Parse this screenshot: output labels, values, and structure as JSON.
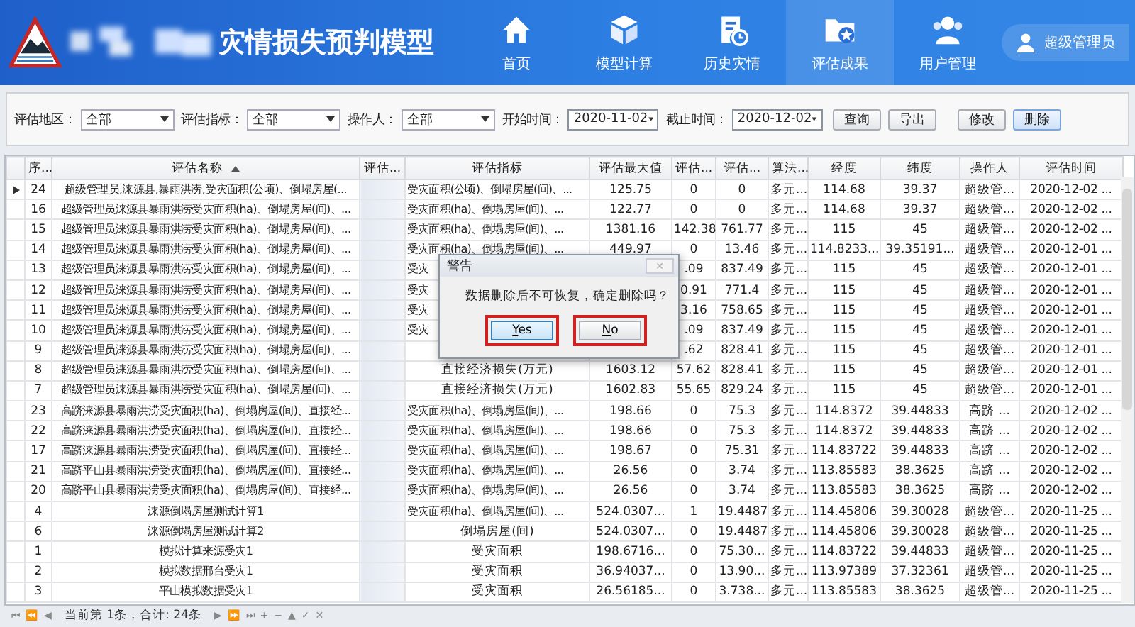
{
  "header": {
    "title": "灾情损失预判模型",
    "nav": [
      {
        "label": "首页",
        "selected": false
      },
      {
        "label": "模型计算",
        "selected": false
      },
      {
        "label": "历史灾情",
        "selected": false
      },
      {
        "label": "评估成果",
        "selected": true
      },
      {
        "label": "用户管理",
        "selected": false
      }
    ],
    "user": "超级管理员"
  },
  "filters": [
    {
      "label": "评估地区：",
      "value": "全部",
      "kind": "select"
    },
    {
      "label": "评估指标：",
      "value": "全部",
      "kind": "select"
    },
    {
      "label": "操作人：",
      "value": "全部",
      "kind": "select"
    },
    {
      "label": "开始时间：",
      "value": "2020-11-02",
      "kind": "date"
    },
    {
      "label": "截止时间：",
      "value": "2020-12-02",
      "kind": "date"
    }
  ],
  "actions": [
    {
      "label": "查询",
      "highlighted": false
    },
    {
      "label": "导出",
      "highlighted": false
    },
    {
      "label": "修改",
      "highlighted": false
    },
    {
      "label": "删除",
      "highlighted": true
    }
  ],
  "table": {
    "columns": [
      {
        "label": "序..."
      },
      {
        "label": "评估名称",
        "sorted_ascending": true
      },
      {
        "label": "评估..."
      },
      {
        "label": "评估指标"
      },
      {
        "label": "评估最大值"
      },
      {
        "label": "评估..."
      },
      {
        "label": "评估..."
      },
      {
        "label": "算法..."
      },
      {
        "label": "经度"
      },
      {
        "label": "纬度"
      },
      {
        "label": "操作人"
      },
      {
        "label": "评估时间"
      }
    ],
    "rows": [
      {
        "selected": true,
        "no": "24",
        "name": "超级管理员,涞源县,暴雨洪涝,受灾面积(公顷)、倒塌房屋(...",
        "indicator": "受灾面积(公顷)、倒塌房屋(间)、...",
        "max": "125.75",
        "v1": "0",
        "v2": "0",
        "algo": "多元...",
        "lon": "114.68",
        "lat": "39.37",
        "operator": "超级管...",
        "time": "2020-12-02 ..."
      },
      {
        "selected": false,
        "no": "16",
        "name": "超级管理员涞源县暴雨洪涝受灾面积(ha)、倒塌房屋(间)、...",
        "indicator": "受灾面积(ha)、倒塌房屋(间)、...",
        "max": "122.77",
        "v1": "0",
        "v2": "0",
        "algo": "多元...",
        "lon": "114.68",
        "lat": "39.37",
        "operator": "超级管...",
        "time": "2020-12-02 ..."
      },
      {
        "selected": false,
        "no": "15",
        "name": "超级管理员涞源县暴雨洪涝受灾面积(ha)、倒塌房屋(间)、...",
        "indicator": "受灾面积(ha)、倒塌房屋(间)、...",
        "max": "1381.16",
        "v1": "142.38",
        "v2": "761.77",
        "algo": "多元...",
        "lon": "115",
        "lat": "45",
        "operator": "超级管...",
        "time": "2020-12-02 ..."
      },
      {
        "selected": false,
        "no": "14",
        "name": "超级管理员涞源县暴雨洪涝受灾面积(ha)、倒塌房屋(间)、...",
        "indicator": "受灾面积(ha)、倒塌房屋(间)、...",
        "max": "449.97",
        "v1": "0",
        "v2": "13.46",
        "algo": "多元...",
        "lon": "114.8233...",
        "lat": "39.35191...",
        "operator": "超级管...",
        "time": "2020-12-01 ..."
      },
      {
        "selected": false,
        "no": "13",
        "name": "超级管理员涞源县暴雨洪涝受灾面积(ha)、倒塌房屋(间)、...",
        "indicator": "受灾",
        "v1": ".09",
        "v2": "837.49",
        "algo": "多元...",
        "lon": "115",
        "lat": "45",
        "operator": "超级管...",
        "time": "2020-12-01 ..."
      },
      {
        "selected": false,
        "no": "12",
        "name": "超级管理员涞源县暴雨洪涝受灾面积(ha)、倒塌房屋(间)、...",
        "indicator": "受灾",
        "v1": "0.91",
        "v2": "771.4",
        "algo": "多元...",
        "lon": "115",
        "lat": "45",
        "operator": "超级管...",
        "time": "2020-12-01 ..."
      },
      {
        "selected": false,
        "no": "11",
        "name": "超级管理员涞源县暴雨洪涝受灾面积(ha)、倒塌房屋(间)、...",
        "indicator": "受灾",
        "v1": "3.16",
        "v2": "758.65",
        "algo": "多元...",
        "lon": "115",
        "lat": "45",
        "operator": "超级管...",
        "time": "2020-12-01 ..."
      },
      {
        "selected": false,
        "no": "10",
        "name": "超级管理员涞源县暴雨洪涝受灾面积(ha)、倒塌房屋(间)、...",
        "indicator": "受灾",
        "v1": ".09",
        "v2": "837.49",
        "algo": "多元...",
        "lon": "115",
        "lat": "45",
        "operator": "超级管...",
        "time": "2020-12-01 ..."
      },
      {
        "selected": false,
        "no": "9",
        "name": "超级管理员涞源县暴雨洪涝受灾面积(ha)、倒塌房屋(间)、...",
        "v1": ".62",
        "v2": "828.41",
        "algo": "多元...",
        "lon": "115",
        "lat": "45",
        "operator": "超级管...",
        "time": "2020-12-01 ..."
      },
      {
        "selected": false,
        "no": "8",
        "name": "超级管理员涞源县暴雨洪涝受灾面积(ha)、倒塌房屋(间)、...",
        "indicator": "直接经济损失(万元)",
        "max": "1603.12",
        "v1": "57.62",
        "v2": "828.41",
        "algo": "多元...",
        "lon": "115",
        "lat": "45",
        "operator": "超级管...",
        "time": "2020-12-01 ..."
      },
      {
        "selected": false,
        "no": "7",
        "name": "超级管理员涞源县暴雨洪涝受灾面积(ha)、倒塌房屋(间)、...",
        "indicator": "直接经济损失(万元)",
        "max": "1602.83",
        "v1": "55.65",
        "v2": "829.24",
        "algo": "多元...",
        "lon": "115",
        "lat": "45",
        "operator": "超级管...",
        "time": "2020-12-01 ..."
      },
      {
        "selected": false,
        "no": "23",
        "name": "高跻涞源县暴雨洪涝受灾面积(ha)、倒塌房屋(间)、直接经...",
        "indicator": "受灾面积(ha)、倒塌房屋(间)、...",
        "max": "198.66",
        "v1": "0",
        "v2": "75.3",
        "algo": "多元...",
        "lon": "114.8372",
        "lat": "39.44833",
        "operator": "高跻 ...",
        "time": "2020-12-02 ..."
      },
      {
        "selected": false,
        "no": "22",
        "name": "高跻涞源县暴雨洪涝受灾面积(ha)、倒塌房屋(间)、直接经...",
        "indicator": "受灾面积(ha)、倒塌房屋(间)、...",
        "max": "198.66",
        "v1": "0",
        "v2": "75.3",
        "algo": "多元...",
        "lon": "114.8372",
        "lat": "39.44833",
        "operator": "高跻 ...",
        "time": "2020-12-02 ..."
      },
      {
        "selected": false,
        "no": "17",
        "name": "高跻涞源县暴雨洪涝受灾面积(ha)、倒塌房屋(间)、直接经...",
        "indicator": "受灾面积(ha)、倒塌房屋(间)、...",
        "max": "198.67",
        "v1": "0",
        "v2": "75.31",
        "algo": "多元...",
        "lon": "114.83722",
        "lat": "39.44833",
        "operator": "高跻 ...",
        "time": "2020-12-02 ..."
      },
      {
        "selected": false,
        "no": "21",
        "name": "高跻平山县暴雨洪涝受灾面积(ha)、倒塌房屋(间)、直接经...",
        "indicator": "受灾面积(ha)、倒塌房屋(间)、...",
        "max": "26.56",
        "v1": "0",
        "v2": "3.74",
        "algo": "多元...",
        "lon": "113.85583",
        "lat": "38.3625",
        "operator": "高跻 ...",
        "time": "2020-12-02 ..."
      },
      {
        "selected": false,
        "no": "20",
        "name": "高跻平山县暴雨洪涝受灾面积(ha)、倒塌房屋(间)、直接经...",
        "indicator": "受灾面积(ha)、倒塌房屋(间)、...",
        "max": "26.56",
        "v1": "0",
        "v2": "3.74",
        "algo": "多元...",
        "lon": "113.85583",
        "lat": "38.3625",
        "operator": "高跻 ...",
        "time": "2020-12-02 ..."
      },
      {
        "selected": false,
        "no": "4",
        "name": "涞源倒塌房屋测试计算1",
        "indicator": "受灾面积(ha)、倒塌房屋(间)、...",
        "max": "524.0307...",
        "v1": "1",
        "v2": "19.4487",
        "algo": "多元...",
        "lon": "114.45806",
        "lat": "39.30028",
        "operator": "超级管...",
        "time": "2020-11-25 ..."
      },
      {
        "selected": false,
        "no": "6",
        "name": "涞源倒塌房屋测试计算2",
        "indicator": "倒塌房屋(间)",
        "max": "524.0307...",
        "v1": "0",
        "v2": "19.4487",
        "algo": "多元...",
        "lon": "114.45806",
        "lat": "39.30028",
        "operator": "超级管...",
        "time": "2020-11-25 ..."
      },
      {
        "selected": false,
        "no": "1",
        "name": "模拟计算来源受灾1",
        "indicator": "受灾面积",
        "max": "198.6716...",
        "v1": "0",
        "v2": "75.30...",
        "algo": "多元...",
        "lon": "114.83722",
        "lat": "39.44833",
        "operator": "超级管...",
        "time": "2020-11-25 ..."
      },
      {
        "selected": false,
        "no": "2",
        "name": "模拟数据邢台受灾1",
        "indicator": "受灾面积",
        "max": "36.94037...",
        "v1": "0",
        "v2": "13.90...",
        "algo": "多元...",
        "lon": "113.97389",
        "lat": "37.32361",
        "operator": "超级管...",
        "time": "2020-11-25 ..."
      },
      {
        "selected": false,
        "no": "3",
        "name": "平山模拟数据受灾1",
        "indicator": "受灾面积",
        "max": "26.56185...",
        "v1": "0",
        "v2": "3.738...",
        "algo": "多元...",
        "lon": "113.85583",
        "lat": "38.3625",
        "operator": "超级管...",
        "time": "2020-11-25 ..."
      }
    ]
  },
  "navigator": {
    "before": [
      "⏮",
      "⏪",
      "◀"
    ],
    "status": "当前第 1条，合计: 24条",
    "after": [
      "▶",
      "⏩",
      "⏭",
      "+",
      "−",
      "▲",
      "✓",
      "✕"
    ]
  },
  "dialog": {
    "title": "警告",
    "close": "✕",
    "message": "数据删除后不可恢复，确定删除吗？",
    "buttons": [
      {
        "label": "Yes",
        "focused": true,
        "annotated": true
      },
      {
        "label": "No",
        "focused": false,
        "annotated": true
      }
    ]
  }
}
